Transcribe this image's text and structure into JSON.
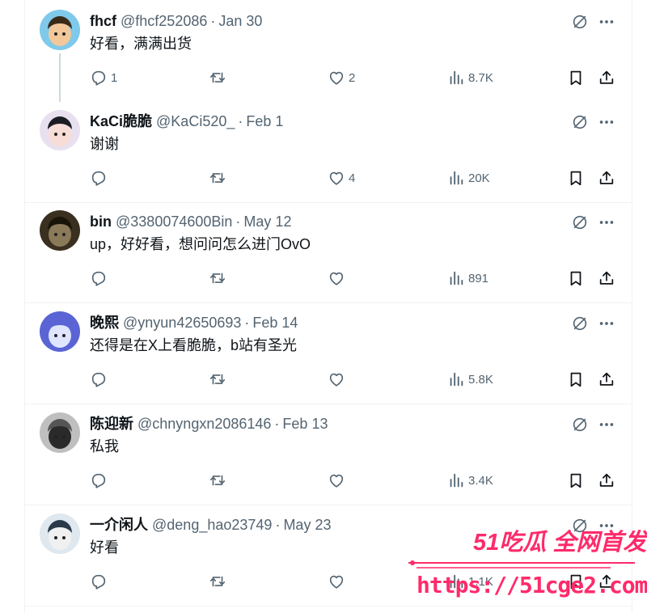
{
  "tweets": [
    {
      "name": "fhcf",
      "handle": "@fhcf252086",
      "date": "Jan 30",
      "text": "好看，满满出货",
      "replies": "1",
      "likes": "2",
      "views": "8.7K"
    },
    {
      "name": "KaCi脆脆",
      "handle": "@KaCi520_",
      "date": "Feb 1",
      "text": "谢谢",
      "replies": "",
      "likes": "4",
      "views": "20K"
    },
    {
      "name": "bin",
      "handle": "@3380074600Bin",
      "date": "May 12",
      "text": "up，好好看，想问问怎么进门OvO",
      "replies": "",
      "likes": "",
      "views": "891"
    },
    {
      "name": "晚熙",
      "handle": "@ynyun42650693",
      "date": "Feb 14",
      "text": "还得是在X上看脆脆，b站有圣光",
      "replies": "",
      "likes": "",
      "views": "5.8K"
    },
    {
      "name": "陈迎新",
      "handle": "@chnyngxn2086146",
      "date": "Feb 13",
      "text": "私我",
      "replies": "",
      "likes": "",
      "views": "3.4K"
    },
    {
      "name": "一介闲人",
      "handle": "@deng_hao23749",
      "date": "May 23",
      "text": "好看",
      "replies": "",
      "likes": "",
      "views": "1.1K"
    }
  ],
  "separator": "·",
  "watermark": {
    "top": "51吃瓜 全网首发",
    "url": "https://51cge2.com"
  },
  "colors": {
    "muted": "#536471",
    "border": "#eff3f4",
    "watermark": "#ff2a6a"
  }
}
